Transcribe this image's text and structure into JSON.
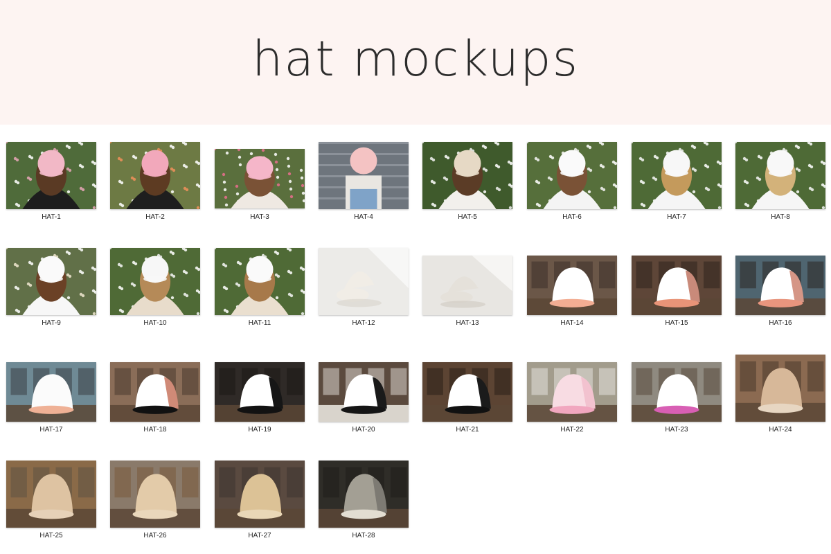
{
  "title": "hat mockups",
  "items": [
    {
      "label": "HAT-1",
      "scene": "flowers",
      "cap": "#f2b8c6",
      "person": "#1d1d1d",
      "hair": "#5a3a24",
      "bg": "#4f6b3a",
      "accent": "#e7a7b8"
    },
    {
      "label": "HAT-2",
      "scene": "flowers",
      "cap": "#f2a8bb",
      "person": "#1e1e1e",
      "hair": "#5d3b22",
      "bg": "#6d7a44",
      "accent": "#f0905b"
    },
    {
      "label": "HAT-3",
      "scene": "flowers",
      "cap": "#f5b6c9",
      "person": "#efe9e2",
      "hair": "#7a5236",
      "bg": "#5a6f3d",
      "accent": "#ea6f8e"
    },
    {
      "label": "HAT-4",
      "scene": "steps",
      "cap": "#f4c3c3",
      "person": "#e9e6e1",
      "hair": "#a07850",
      "bg": "#6e757d",
      "accent": "#7fa3c8"
    },
    {
      "label": "HAT-5",
      "scene": "flowers",
      "cap": "#e6d9c5",
      "person": "#f2f0ec",
      "hair": "#5b3c26",
      "bg": "#3f5a2c",
      "accent": "#f2f2f2"
    },
    {
      "label": "HAT-6",
      "scene": "flowers",
      "cap": "#fafafa",
      "person": "#f4f4f4",
      "hair": "#7a5236",
      "bg": "#566f3b",
      "accent": "#f5f5f5"
    },
    {
      "label": "HAT-7",
      "scene": "flowers",
      "cap": "#f7f7f7",
      "person": "#f5f5f5",
      "hair": "#c49a5c",
      "bg": "#4e6a36",
      "accent": "#f5f5f5"
    },
    {
      "label": "HAT-8",
      "scene": "flowers",
      "cap": "#f8f8f8",
      "person": "#f6f6f6",
      "hair": "#d3b27a",
      "bg": "#4e6a36",
      "accent": "#f5f5f5"
    },
    {
      "label": "HAT-9",
      "scene": "flowers",
      "cap": "#fafafa",
      "person": "#f7f7f7",
      "hair": "#6b4126",
      "bg": "#617048",
      "accent": "#f0e6d0"
    },
    {
      "label": "HAT-10",
      "scene": "flowers",
      "cap": "#f7f7f7",
      "person": "#e8dccb",
      "hair": "#b58a58",
      "bg": "#4f6a36",
      "accent": "#f5f5f5"
    },
    {
      "label": "HAT-11",
      "scene": "flowers",
      "cap": "#fafafa",
      "person": "#eadfcf",
      "hair": "#a7794a",
      "bg": "#4f6a36",
      "accent": "#f5f5f5"
    },
    {
      "label": "HAT-12",
      "scene": "studio",
      "cap": "#f1ede6",
      "person": "",
      "hair": "",
      "bg": "#ecebe8",
      "accent": "#d8d4cc"
    },
    {
      "label": "HAT-13",
      "scene": "studio",
      "cap": "#e5e1da",
      "person": "",
      "hair": "",
      "bg": "#e8e6e2",
      "accent": "#cfcac1"
    },
    {
      "label": "HAT-14",
      "scene": "room",
      "cap": "#ffffff",
      "person": "#f3ad93",
      "hair": "",
      "bg": "#6b5748",
      "accent": "#3d3029"
    },
    {
      "label": "HAT-15",
      "scene": "room",
      "cap": "#ffffff",
      "person": "#e99478",
      "hair": "#c98a7a",
      "bg": "#5e4638",
      "accent": "#2f241e"
    },
    {
      "label": "HAT-16",
      "scene": "room",
      "cap": "#ffffff",
      "person": "#e8957e",
      "hair": "#d59686",
      "bg": "#4f6570",
      "accent": "#2c2622"
    },
    {
      "label": "HAT-17",
      "scene": "room",
      "cap": "#fbfbfb",
      "person": "#efb196",
      "hair": "",
      "bg": "#6f8a95",
      "accent": "#3a4045"
    },
    {
      "label": "HAT-18",
      "scene": "room",
      "cap": "#ffffff",
      "person": "#111111",
      "hair": "#d08a77",
      "bg": "#8a6d58",
      "accent": "#4a3a30"
    },
    {
      "label": "HAT-19",
      "scene": "room",
      "cap": "#ffffff",
      "person": "#121212",
      "hair": "#161616",
      "bg": "#2f2a27",
      "accent": "#1c1815"
    },
    {
      "label": "HAT-20",
      "scene": "bed",
      "cap": "#ffffff",
      "person": "#151515",
      "hair": "#1a1a1a",
      "bg": "#5b4a3e",
      "accent": "#d9d4cc"
    },
    {
      "label": "HAT-21",
      "scene": "room",
      "cap": "#ffffff",
      "person": "#111111",
      "hair": "#1b1b1b",
      "bg": "#5c4433",
      "accent": "#2b2018"
    },
    {
      "label": "HAT-22",
      "scene": "room",
      "cap": "#f8dce3",
      "person": "#f1a7bf",
      "hair": "#f2c2cf",
      "bg": "#a29c8c",
      "accent": "#e4e2dc"
    },
    {
      "label": "HAT-23",
      "scene": "room",
      "cap": "#ffffff",
      "person": "#d85fb4",
      "hair": "",
      "bg": "#8f8a80",
      "accent": "#5a4a3c"
    },
    {
      "label": "HAT-24",
      "scene": "room",
      "cap": "#d7b899",
      "person": "#e7d6c2",
      "hair": "",
      "bg": "#8b6a51",
      "accent": "#4b392c"
    },
    {
      "label": "HAT-25",
      "scene": "room",
      "cap": "#dec3a2",
      "person": "#e6d1b8",
      "hair": "",
      "bg": "#8a6a48",
      "accent": "#5f5244"
    },
    {
      "label": "HAT-26",
      "scene": "room",
      "cap": "#e3cba9",
      "person": "#ead7bb",
      "hair": "",
      "bg": "#8a7a6a",
      "accent": "#7a5a3a"
    },
    {
      "label": "HAT-27",
      "scene": "room",
      "cap": "#dcc296",
      "person": "#e9d7b7",
      "hair": "",
      "bg": "#5a4a40",
      "accent": "#3e3530"
    },
    {
      "label": "HAT-28",
      "scene": "room",
      "cap": "#a39f94",
      "person": "#e2ddd2",
      "hair": "#7d7a73",
      "bg": "#2f2d28",
      "accent": "#1f1d19"
    }
  ]
}
